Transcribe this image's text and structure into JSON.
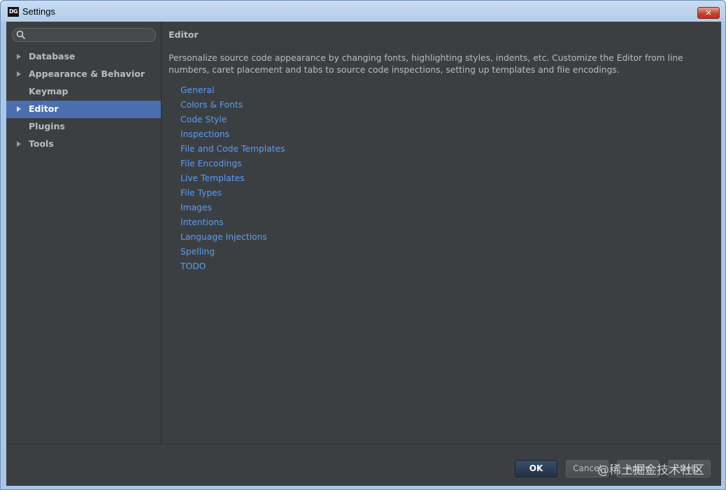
{
  "window": {
    "title": "Settings",
    "app_icon_text": "DG",
    "close_symbol": "✕"
  },
  "search": {
    "value": "",
    "placeholder": "",
    "icon": "search-icon"
  },
  "sidebar": {
    "items": [
      {
        "label": "Database",
        "expandable": true,
        "selected": false
      },
      {
        "label": "Appearance & Behavior",
        "expandable": true,
        "selected": false
      },
      {
        "label": "Keymap",
        "expandable": false,
        "selected": false
      },
      {
        "label": "Editor",
        "expandable": true,
        "selected": true
      },
      {
        "label": "Plugins",
        "expandable": false,
        "selected": false
      },
      {
        "label": "Tools",
        "expandable": true,
        "selected": false
      }
    ]
  },
  "content": {
    "title": "Editor",
    "description": "Personalize source code appearance by changing fonts, highlighting styles, indents, etc. Customize the Editor from line numbers, caret placement and tabs to source code inspections, setting up templates and file encodings.",
    "links": [
      "General",
      "Colors & Fonts",
      "Code Style",
      "Inspections",
      "File and Code Templates",
      "File Encodings",
      "Live Templates",
      "File Types",
      "Images",
      "Intentions",
      "Language Injections",
      "Spelling",
      "TODO"
    ]
  },
  "footer": {
    "ok_label": "OK",
    "cancel_label": "Cancel",
    "apply_label": "Apply",
    "help_label": "Help"
  },
  "watermark": "@稀土掘金技术社区",
  "colors": {
    "background": "#3c3f41",
    "text": "#bbbbbb",
    "link": "#589df6",
    "selection": "#4b6eaf"
  }
}
